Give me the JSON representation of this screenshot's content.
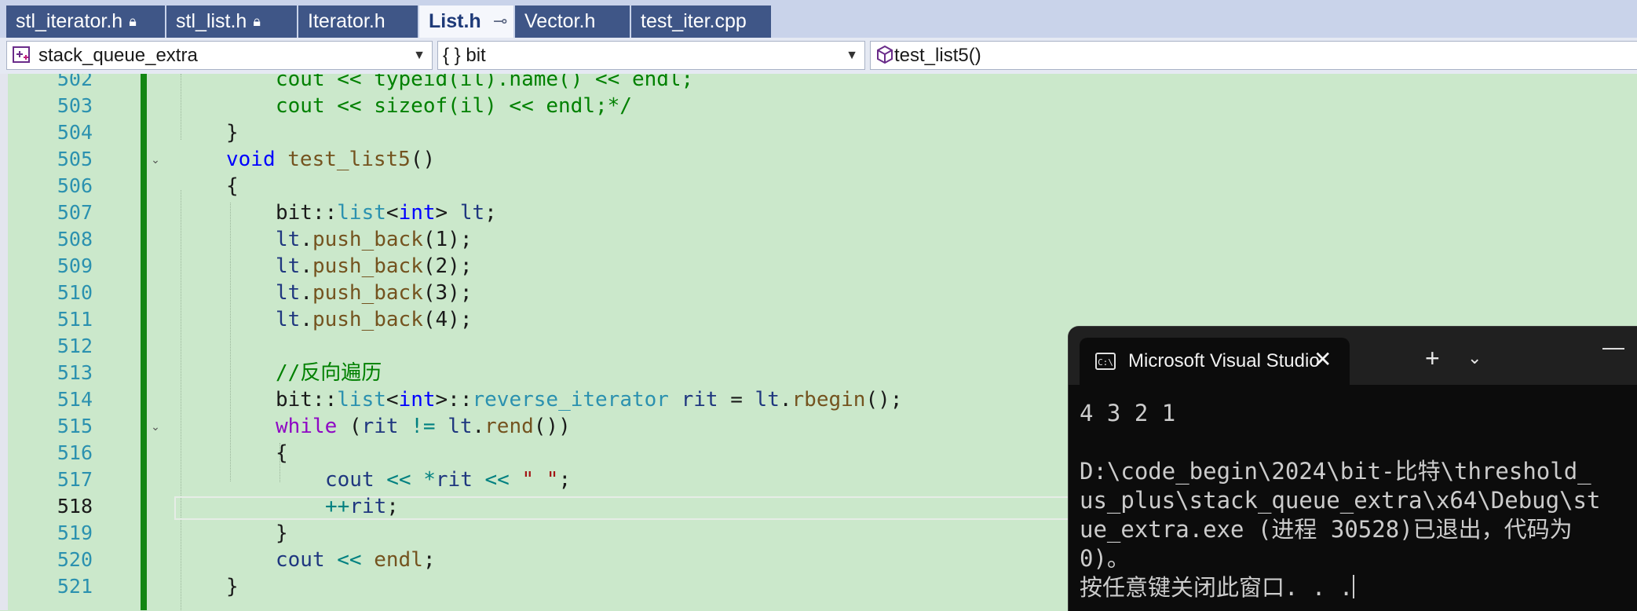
{
  "tabs": [
    {
      "label": "stl_iterator.h",
      "locked": true
    },
    {
      "label": "stl_list.h",
      "locked": true
    },
    {
      "label": "Iterator.h",
      "locked": false
    },
    {
      "label": "List.h",
      "locked": false,
      "active": true
    },
    {
      "label": "Vector.h",
      "locked": false
    },
    {
      "label": "test_iter.cpp",
      "locked": false
    }
  ],
  "navbar": {
    "project": "stack_queue_extra",
    "scope": "{ } bit",
    "member": "test_list5()"
  },
  "editor": {
    "lines": [
      {
        "n": "502",
        "segs": [
          {
            "t": "cout << typeid(il).name() << endl;",
            "c": "cm"
          }
        ]
      },
      {
        "n": "503",
        "segs": [
          {
            "t": "cout << sizeof(il) << endl;*/",
            "c": "cm"
          }
        ]
      },
      {
        "n": "504",
        "segs": [
          {
            "t": "}",
            "c": ""
          }
        ]
      },
      {
        "n": "505",
        "segs": [
          {
            "t": "void",
            "c": "kw"
          },
          {
            "t": " ",
            "c": ""
          },
          {
            "t": "test_list5",
            "c": "fn"
          },
          {
            "t": "()",
            "c": ""
          }
        ]
      },
      {
        "n": "506",
        "segs": [
          {
            "t": "{",
            "c": ""
          }
        ]
      },
      {
        "n": "507",
        "segs": [
          {
            "t": "bit",
            "c": ""
          },
          {
            "t": "::",
            "c": ""
          },
          {
            "t": "list",
            "c": "ty"
          },
          {
            "t": "<",
            "c": ""
          },
          {
            "t": "int",
            "c": "kw"
          },
          {
            "t": "> ",
            "c": ""
          },
          {
            "t": "lt",
            "c": "var"
          },
          {
            "t": ";",
            "c": ""
          }
        ]
      },
      {
        "n": "508",
        "segs": [
          {
            "t": "lt",
            "c": "var"
          },
          {
            "t": ".",
            "c": ""
          },
          {
            "t": "push_back",
            "c": "fn"
          },
          {
            "t": "(1);",
            "c": ""
          }
        ]
      },
      {
        "n": "509",
        "segs": [
          {
            "t": "lt",
            "c": "var"
          },
          {
            "t": ".",
            "c": ""
          },
          {
            "t": "push_back",
            "c": "fn"
          },
          {
            "t": "(2);",
            "c": ""
          }
        ]
      },
      {
        "n": "510",
        "segs": [
          {
            "t": "lt",
            "c": "var"
          },
          {
            "t": ".",
            "c": ""
          },
          {
            "t": "push_back",
            "c": "fn"
          },
          {
            "t": "(3);",
            "c": ""
          }
        ]
      },
      {
        "n": "511",
        "segs": [
          {
            "t": "lt",
            "c": "var"
          },
          {
            "t": ".",
            "c": ""
          },
          {
            "t": "push_back",
            "c": "fn"
          },
          {
            "t": "(4);",
            "c": ""
          }
        ]
      },
      {
        "n": "512",
        "segs": []
      },
      {
        "n": "513",
        "segs": [
          {
            "t": "//反向遍历",
            "c": "cm"
          }
        ]
      },
      {
        "n": "514",
        "segs": [
          {
            "t": "bit",
            "c": ""
          },
          {
            "t": "::",
            "c": ""
          },
          {
            "t": "list",
            "c": "ty"
          },
          {
            "t": "<",
            "c": ""
          },
          {
            "t": "int",
            "c": "kw"
          },
          {
            "t": ">::",
            "c": ""
          },
          {
            "t": "reverse_iterator",
            "c": "ty"
          },
          {
            "t": " ",
            "c": ""
          },
          {
            "t": "rit",
            "c": "var"
          },
          {
            "t": " = ",
            "c": ""
          },
          {
            "t": "lt",
            "c": "var"
          },
          {
            "t": ".",
            "c": ""
          },
          {
            "t": "rbegin",
            "c": "fn"
          },
          {
            "t": "();",
            "c": ""
          }
        ]
      },
      {
        "n": "515",
        "segs": [
          {
            "t": "while",
            "c": "ctl"
          },
          {
            "t": " (",
            "c": ""
          },
          {
            "t": "rit",
            "c": "var"
          },
          {
            "t": " ",
            "c": ""
          },
          {
            "t": "!=",
            "c": "op"
          },
          {
            "t": " ",
            "c": ""
          },
          {
            "t": "lt",
            "c": "var"
          },
          {
            "t": ".",
            "c": ""
          },
          {
            "t": "rend",
            "c": "fn"
          },
          {
            "t": "())",
            "c": ""
          }
        ]
      },
      {
        "n": "516",
        "segs": [
          {
            "t": "{",
            "c": ""
          }
        ]
      },
      {
        "n": "517",
        "segs": [
          {
            "t": "cout",
            "c": "var"
          },
          {
            "t": " ",
            "c": ""
          },
          {
            "t": "<<",
            "c": "op"
          },
          {
            "t": " ",
            "c": ""
          },
          {
            "t": "*",
            "c": "op"
          },
          {
            "t": "rit",
            "c": "var"
          },
          {
            "t": " ",
            "c": ""
          },
          {
            "t": "<<",
            "c": "op"
          },
          {
            "t": " ",
            "c": ""
          },
          {
            "t": "\" \"",
            "c": "str"
          },
          {
            "t": ";",
            "c": ""
          }
        ]
      },
      {
        "n": "518",
        "segs": [
          {
            "t": "++",
            "c": "op"
          },
          {
            "t": "rit",
            "c": "var"
          },
          {
            "t": ";",
            "c": ""
          }
        ]
      },
      {
        "n": "519",
        "segs": [
          {
            "t": "}",
            "c": ""
          }
        ]
      },
      {
        "n": "520",
        "segs": [
          {
            "t": "cout",
            "c": "var"
          },
          {
            "t": " ",
            "c": ""
          },
          {
            "t": "<<",
            "c": "op"
          },
          {
            "t": " ",
            "c": ""
          },
          {
            "t": "endl",
            "c": "fn"
          },
          {
            "t": ";",
            "c": ""
          }
        ]
      },
      {
        "n": "521",
        "segs": [
          {
            "t": "}",
            "c": ""
          }
        ]
      }
    ]
  },
  "terminal": {
    "title": "Microsoft Visual Studio",
    "close_glyph": "✕",
    "plus_glyph": "+",
    "chevron_glyph": "⌄",
    "minimize_glyph": "—",
    "lines": [
      "4 3 2 1",
      "",
      "D:\\code_begin\\2024\\bit-比特\\threshold_",
      "us_plus\\stack_queue_extra\\x64\\Debug\\st",
      "ue_extra.exe (进程 30528)已退出，代码为",
      "0)。",
      "按任意键关闭此窗口. . ."
    ]
  },
  "colors": {
    "editor_bg": "#cbe8cb",
    "change_bar": "#138613",
    "tab_active_text": "#1e3a78",
    "tab_inactive_bg": "#3f5687",
    "terminal_bg": "#0c0c0c"
  }
}
